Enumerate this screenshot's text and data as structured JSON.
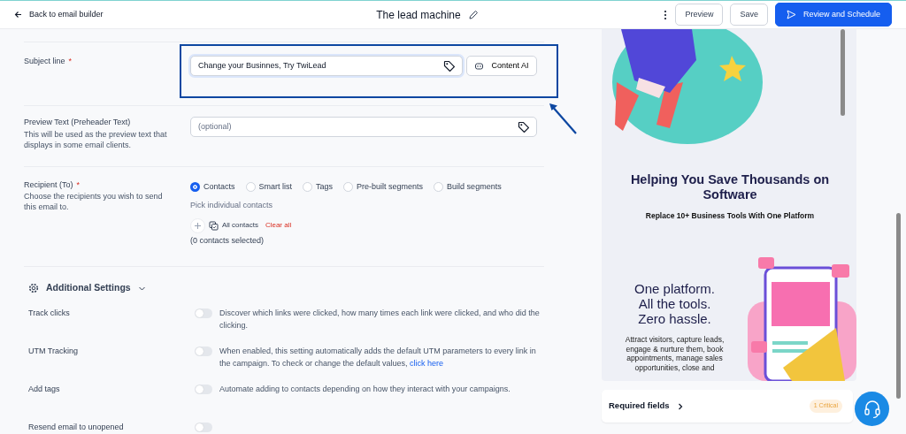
{
  "header": {
    "back_link": "Back to email builder",
    "title": "The lead machine",
    "buttons": [
      {
        "label": "Preview",
        "kind": "outline"
      },
      {
        "label": "Save",
        "kind": "outline"
      },
      {
        "label": "Review and Schedule",
        "kind": "primary"
      }
    ]
  },
  "subject": {
    "label": "Subject line",
    "required_mark": "*",
    "value": "Change your Businnes, Try TwiLead",
    "button": "Content AI"
  },
  "preview_text": {
    "label": "Preview Text (Preheader Text)",
    "help": "This will be used as the preview text that displays in some email clients.",
    "placeholder": "(optional)"
  },
  "recipient": {
    "label": "Recipient (To)",
    "required_mark": "*",
    "help": "Choose the recipients you wish to send this email to.",
    "options": [
      {
        "label": "Contacts",
        "selected": true
      },
      {
        "label": "Smart list",
        "selected": false
      },
      {
        "label": "Tags",
        "selected": false
      },
      {
        "label": "Pre-built segments",
        "selected": false
      },
      {
        "label": "Build segments",
        "selected": false
      }
    ],
    "hint": "Pick individual contacts",
    "all_contacts": "All contacts",
    "clear_all": "Clear all",
    "count": "(0 contacts selected)"
  },
  "additional_settings": {
    "title": "Additional Settings",
    "expanded": true,
    "items": [
      {
        "label": "Track clicks",
        "on": false,
        "description": "Discover which links were clicked, how many times each link were clicked, and who did the clicking."
      },
      {
        "label": "UTM Tracking",
        "on": false,
        "description": "When enabled, this setting automatically adds the default UTM parameters to every link in the campaign. To check or change the default values,",
        "link": "click here"
      },
      {
        "label": "Add tags",
        "on": false,
        "description": "Automate adding to contacts depending on how they interact with your campaigns."
      },
      {
        "label": "Resend email to unopened",
        "on": false
      }
    ]
  },
  "email_preview": {
    "heading": "Helping You Save Thousands on Software",
    "subheading": "Replace 10+ Business Tools With One Platform",
    "tagline": [
      "One platform.",
      "All the tools.",
      "Zero hassle."
    ],
    "body": "Attract visitors, capture leads, engage & nurture them, book appointments, manage sales opportunities, close and"
  },
  "required_fields": {
    "label": "Required fields",
    "badge": "1 Critical"
  }
}
